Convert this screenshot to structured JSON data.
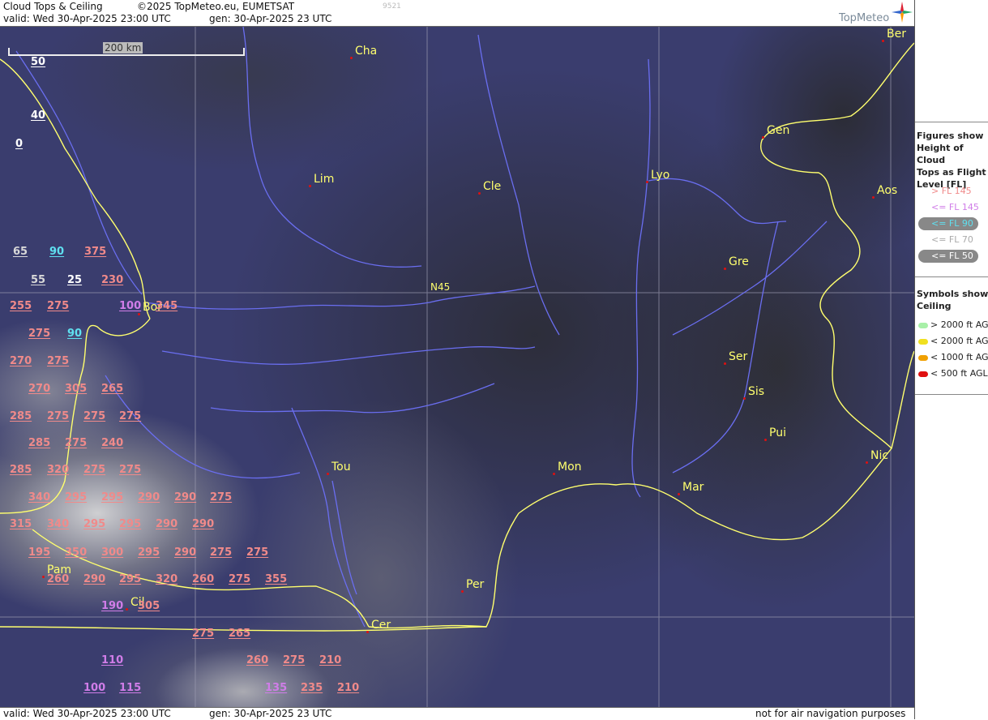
{
  "header": {
    "title": "Cloud Tops & Ceiling",
    "copyright": "©2025 TopMeteo.eu, EUMETSAT",
    "valid": "valid:  Wed  30-Apr-2025  23:00 UTC",
    "gen": "gen: 30-Apr-2025 23 UTC",
    "code": "9521",
    "logo_text": "TopMeteo"
  },
  "footer": {
    "valid": "valid:  Wed  30-Apr-2025  23:00 UTC",
    "gen": "gen: 30-Apr-2025 23 UTC",
    "disclaimer": "not for air navigation purposes"
  },
  "map": {
    "scale_label": "200 km",
    "latitude_label": "N45",
    "cities": [
      {
        "name": "Ber"
      },
      {
        "name": "Cha"
      },
      {
        "name": "Gen"
      },
      {
        "name": "Lim"
      },
      {
        "name": "Cle"
      },
      {
        "name": "Lyo"
      },
      {
        "name": "Aos"
      },
      {
        "name": "Gre"
      },
      {
        "name": "Bor"
      },
      {
        "name": "Ser"
      },
      {
        "name": "Sis"
      },
      {
        "name": "Pui"
      },
      {
        "name": "Nic"
      },
      {
        "name": "Tou"
      },
      {
        "name": "Mon"
      },
      {
        "name": "Mar"
      },
      {
        "name": "Pam"
      },
      {
        "name": "Cil"
      },
      {
        "name": "Per"
      },
      {
        "name": "Cer"
      }
    ],
    "figures": [
      {
        "v": "50",
        "c": "w"
      },
      {
        "v": "40",
        "c": "w"
      },
      {
        "v": "0",
        "c": "w"
      },
      {
        "v": "65",
        "c": "g"
      },
      {
        "v": "90",
        "c": "c"
      },
      {
        "v": "375",
        "c": "p"
      },
      {
        "v": "55",
        "c": "g"
      },
      {
        "v": "25",
        "c": "w"
      },
      {
        "v": "230",
        "c": "p"
      },
      {
        "v": "255",
        "c": "p"
      },
      {
        "v": "275",
        "c": "p"
      },
      {
        "v": "100",
        "c": "v"
      },
      {
        "v": "345",
        "c": "p"
      },
      {
        "v": "275",
        "c": "p"
      },
      {
        "v": "90",
        "c": "c"
      },
      {
        "v": "270",
        "c": "p"
      },
      {
        "v": "275",
        "c": "p"
      },
      {
        "v": "270",
        "c": "p"
      },
      {
        "v": "305",
        "c": "p"
      },
      {
        "v": "265",
        "c": "p"
      },
      {
        "v": "285",
        "c": "p"
      },
      {
        "v": "275",
        "c": "p"
      },
      {
        "v": "275",
        "c": "p"
      },
      {
        "v": "275",
        "c": "p"
      },
      {
        "v": "285",
        "c": "p"
      },
      {
        "v": "275",
        "c": "p"
      },
      {
        "v": "240",
        "c": "p"
      },
      {
        "v": "285",
        "c": "p"
      },
      {
        "v": "320",
        "c": "p"
      },
      {
        "v": "275",
        "c": "p"
      },
      {
        "v": "275",
        "c": "p"
      },
      {
        "v": "340",
        "c": "p"
      },
      {
        "v": "295",
        "c": "p"
      },
      {
        "v": "295",
        "c": "p"
      },
      {
        "v": "290",
        "c": "p"
      },
      {
        "v": "290",
        "c": "p"
      },
      {
        "v": "275",
        "c": "p"
      },
      {
        "v": "315",
        "c": "p"
      },
      {
        "v": "340",
        "c": "p"
      },
      {
        "v": "295",
        "c": "p"
      },
      {
        "v": "295",
        "c": "p"
      },
      {
        "v": "290",
        "c": "p"
      },
      {
        "v": "290",
        "c": "p"
      },
      {
        "v": "195",
        "c": "p"
      },
      {
        "v": "350",
        "c": "p"
      },
      {
        "v": "300",
        "c": "p"
      },
      {
        "v": "295",
        "c": "p"
      },
      {
        "v": "290",
        "c": "p"
      },
      {
        "v": "275",
        "c": "p"
      },
      {
        "v": "275",
        "c": "p"
      },
      {
        "v": "260",
        "c": "p"
      },
      {
        "v": "290",
        "c": "p"
      },
      {
        "v": "295",
        "c": "p"
      },
      {
        "v": "320",
        "c": "p"
      },
      {
        "v": "260",
        "c": "p"
      },
      {
        "v": "275",
        "c": "p"
      },
      {
        "v": "355",
        "c": "p"
      },
      {
        "v": "190",
        "c": "v"
      },
      {
        "v": "305",
        "c": "p"
      },
      {
        "v": "275",
        "c": "p"
      },
      {
        "v": "265",
        "c": "p"
      },
      {
        "v": "110",
        "c": "v"
      },
      {
        "v": "260",
        "c": "p"
      },
      {
        "v": "275",
        "c": "p"
      },
      {
        "v": "210",
        "c": "p"
      },
      {
        "v": "100",
        "c": "v"
      },
      {
        "v": "115",
        "c": "v"
      },
      {
        "v": "135",
        "c": "v"
      },
      {
        "v": "235",
        "c": "p"
      },
      {
        "v": "210",
        "c": "p"
      }
    ]
  },
  "legend": {
    "figures_title": "Figures show\nHeight of Cloud\nTops as Flight\nLevel  [FL]",
    "figures": [
      {
        "label": "> FL 145",
        "color": "#f08a8a",
        "pill": false
      },
      {
        "label": "<= FL 145",
        "color": "#d07de8",
        "pill": false
      },
      {
        "label": "<= FL 90",
        "color": "#5fe0f0",
        "pill": true
      },
      {
        "label": "<= FL 70",
        "color": "#aaaaaa",
        "pill": false
      },
      {
        "label": "<= FL 50",
        "color": "#ffffff",
        "pill": true
      }
    ],
    "symbols_title": "Symbols show\nCeiling",
    "symbols": [
      {
        "label": "> 2000 ft AGL",
        "color": "#a8f0a8"
      },
      {
        "label": "< 2000 ft AGL",
        "color": "#f0e020"
      },
      {
        "label": "< 1000 ft AGL",
        "color": "#f0a000"
      },
      {
        "label": "< 500 ft AGL",
        "color": "#e01010"
      }
    ]
  },
  "colors": {
    "sea": "#3a3d6e",
    "coast": "#ffff6e",
    "river": "#6a6ef0",
    "grid": "#9a9ab0"
  }
}
